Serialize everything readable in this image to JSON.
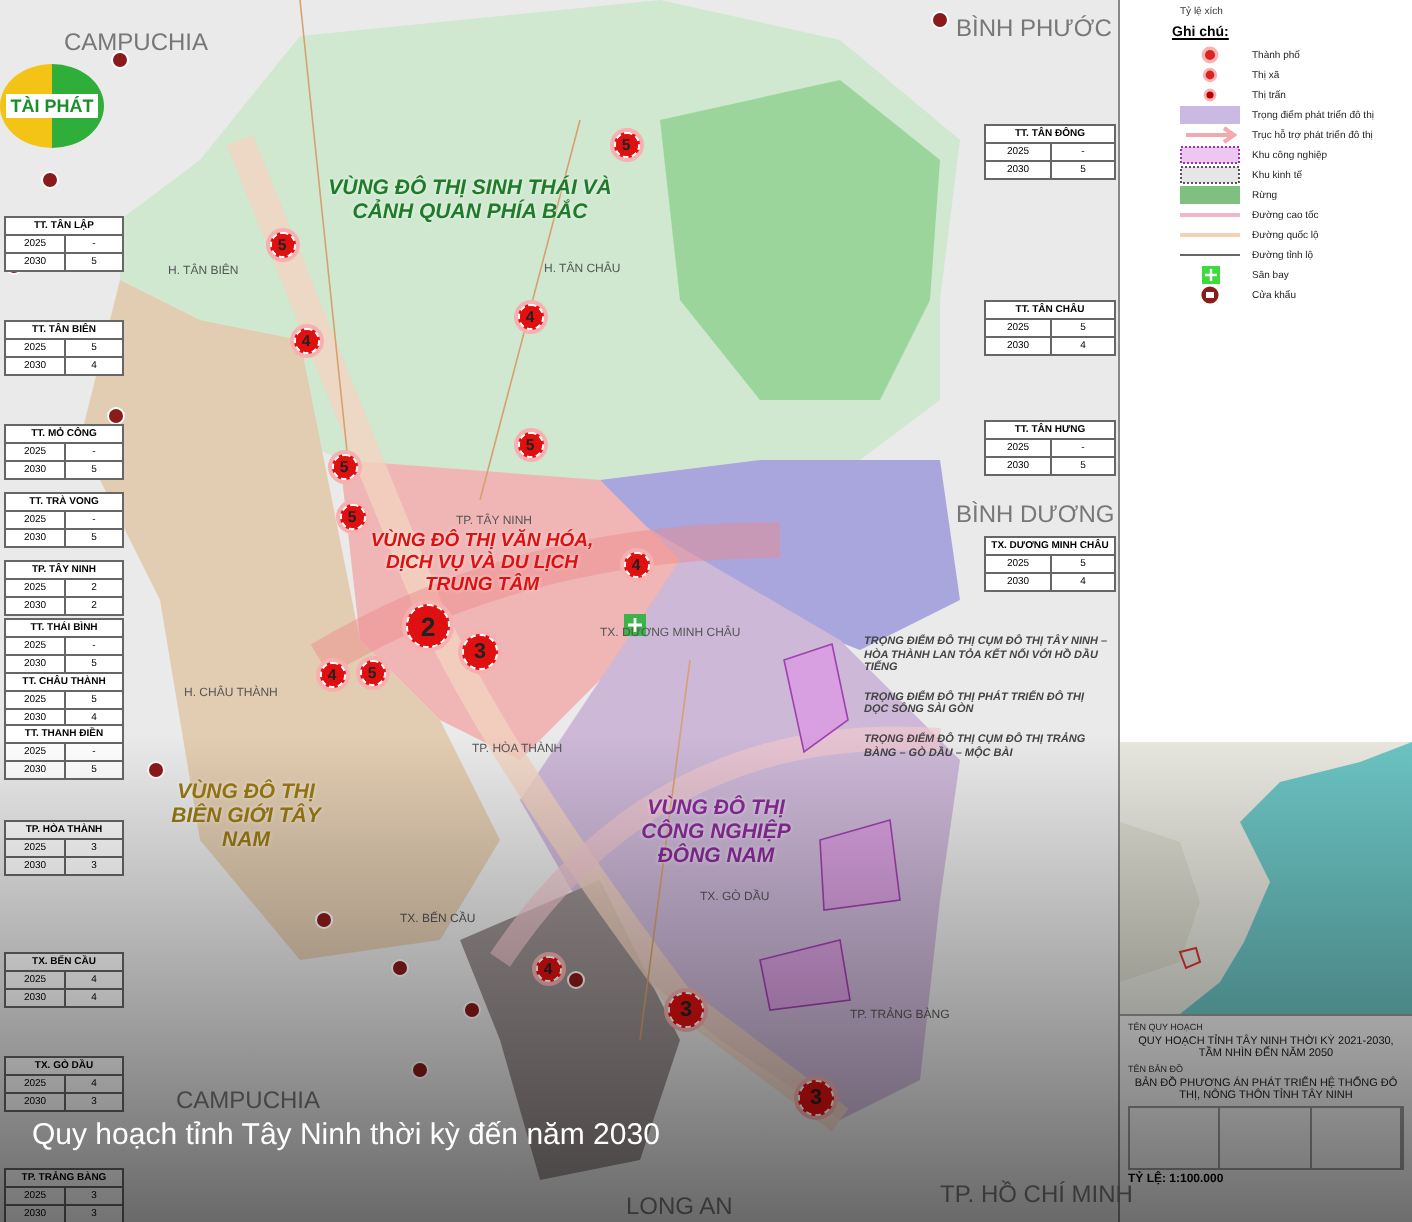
{
  "logo": {
    "text": "TÀI PHÁT"
  },
  "map": {
    "region_labels": [
      {
        "text": "CAMPUCHIA"
      },
      {
        "text": "BÌNH PHƯỚC"
      },
      {
        "text": "BÌNH DƯƠNG"
      },
      {
        "text": "CAMPUCHIA"
      },
      {
        "text": "LONG AN"
      },
      {
        "text": "TP. HỒ CHÍ MINH"
      }
    ],
    "district_labels": [
      {
        "text": "H. TÂN BIÊN"
      },
      {
        "text": "H. TÂN CHÂU"
      },
      {
        "text": "TP. TÂY NINH"
      },
      {
        "text": "TX. DƯƠNG MINH CHÂU"
      },
      {
        "text": "H. CHÂU THÀNH"
      },
      {
        "text": "TP. HÒA THÀNH"
      },
      {
        "text": "TX. GÒ DẦU"
      },
      {
        "text": "TX. BẾN CẦU"
      },
      {
        "text": "TP. TRẢNG BÀNG"
      }
    ],
    "zones": [
      {
        "kind": "eco",
        "text": "VÙNG ĐÔ THỊ SINH THÁI VÀ CẢNH QUAN PHÍA BẮC"
      },
      {
        "kind": "central",
        "text": "VÙNG ĐÔ THỊ VĂN HÓA, DỊCH VỤ VÀ DU LỊCH TRUNG TÂM"
      },
      {
        "kind": "border",
        "text": "VÙNG ĐÔ THỊ BIÊN GIỚI TÂY NAM"
      },
      {
        "kind": "industry",
        "text": "VÙNG ĐÔ THỊ CÔNG NGHIỆP ĐÔNG NAM"
      }
    ],
    "markers": [
      {
        "kind": "town",
        "label": "5"
      },
      {
        "kind": "town",
        "label": "5"
      },
      {
        "kind": "town",
        "label": "4"
      },
      {
        "kind": "town",
        "label": "4"
      },
      {
        "kind": "town",
        "label": "5"
      },
      {
        "kind": "town",
        "label": "5"
      },
      {
        "kind": "town",
        "label": "5"
      },
      {
        "kind": "town",
        "label": "4"
      },
      {
        "kind": "major",
        "label": "2"
      },
      {
        "kind": "town",
        "label": "4"
      },
      {
        "kind": "town",
        "label": "5"
      },
      {
        "kind": "city",
        "label": "3"
      },
      {
        "kind": "town",
        "label": "4"
      },
      {
        "kind": "city",
        "label": "3"
      },
      {
        "kind": "city",
        "label": "3"
      }
    ],
    "notes": [
      "TRỌNG ĐIỂM ĐÔ THỊ CỤM ĐÔ THỊ TÂY NINH – HÒA THÀNH LAN TỎA KẾT NỐI VỚI HỒ DẦU TIẾNG",
      "TRỌNG ĐIỂM ĐÔ THỊ PHÁT TRIỂN ĐÔ THỊ DỌC SÔNG SÀI GÒN",
      "TRỌNG ĐIỂM ĐÔ THỊ CỤM ĐÔ THỊ TRẢNG BÀNG – GÒ DẦU – MỘC BÀI"
    ]
  },
  "left_tables": [
    {
      "title": "TT. TÂN LẬP",
      "rows": [
        [
          "2025",
          "-"
        ],
        [
          "2030",
          "5"
        ]
      ]
    },
    {
      "title": "TT. TÂN BIÊN",
      "rows": [
        [
          "2025",
          "5"
        ],
        [
          "2030",
          "4"
        ]
      ]
    },
    {
      "title": "TT. MỎ CÔNG",
      "rows": [
        [
          "2025",
          "-"
        ],
        [
          "2030",
          "5"
        ]
      ]
    },
    {
      "title": "TT. TRÀ VONG",
      "rows": [
        [
          "2025",
          "-"
        ],
        [
          "2030",
          "5"
        ]
      ]
    },
    {
      "title": "TP. TÂY NINH",
      "rows": [
        [
          "2025",
          "2"
        ],
        [
          "2030",
          "2"
        ]
      ]
    },
    {
      "title": "TT. THÁI BÌNH",
      "rows": [
        [
          "2025",
          "-"
        ],
        [
          "2030",
          "5"
        ]
      ]
    },
    {
      "title": "TT. CHÂU THÀNH",
      "rows": [
        [
          "2025",
          "5"
        ],
        [
          "2030",
          "4"
        ]
      ]
    },
    {
      "title": "TT. THANH ĐIỀN",
      "rows": [
        [
          "2025",
          "-"
        ],
        [
          "2030",
          "5"
        ]
      ]
    },
    {
      "title": "TP. HÒA THÀNH",
      "rows": [
        [
          "2025",
          "3"
        ],
        [
          "2030",
          "3"
        ]
      ]
    },
    {
      "title": "TX. BẾN CẦU",
      "rows": [
        [
          "2025",
          "4"
        ],
        [
          "2030",
          "4"
        ]
      ]
    },
    {
      "title": "TX. GÒ DẦU",
      "rows": [
        [
          "2025",
          "4"
        ],
        [
          "2030",
          "3"
        ]
      ]
    },
    {
      "title": "TP. TRẢNG BÀNG",
      "rows": [
        [
          "2025",
          "3"
        ],
        [
          "2030",
          "3"
        ]
      ]
    }
  ],
  "right_tables": [
    {
      "title": "TT. TÂN ĐÔNG",
      "rows": [
        [
          "2025",
          "-"
        ],
        [
          "2030",
          "5"
        ]
      ]
    },
    {
      "title": "TT. TÂN CHÂU",
      "rows": [
        [
          "2025",
          "5"
        ],
        [
          "2030",
          "4"
        ]
      ]
    },
    {
      "title": "TT. TÂN HƯNG",
      "rows": [
        [
          "2025",
          "-"
        ],
        [
          "2030",
          "5"
        ]
      ]
    },
    {
      "title": "TX. DƯƠNG MINH CHÂU",
      "rows": [
        [
          "2025",
          "5"
        ],
        [
          "2030",
          "4"
        ]
      ]
    }
  ],
  "legend": {
    "scale_label": "Tỷ lệ xích",
    "title": "Ghi chú:",
    "items": [
      {
        "kind": "city",
        "label": "Thành phố"
      },
      {
        "kind": "townlet",
        "label": "Thị xã"
      },
      {
        "kind": "township",
        "label": "Thị trấn"
      },
      {
        "kind": "focus",
        "label": "Trọng điểm phát triển đô thị"
      },
      {
        "kind": "axis",
        "label": "Trục hỗ trợ phát triển đô thị"
      },
      {
        "kind": "industrial",
        "label": "Khu công nghiệp"
      },
      {
        "kind": "economic",
        "label": "Khu kinh tế"
      },
      {
        "kind": "forest",
        "label": "Rừng"
      },
      {
        "kind": "expressway",
        "label": "Đường cao tốc"
      },
      {
        "kind": "highway",
        "label": "Đường quốc lộ"
      },
      {
        "kind": "provincial",
        "label": "Đường tỉnh lộ"
      },
      {
        "kind": "airport",
        "label": "Sân bay"
      },
      {
        "kind": "gate",
        "label": "Cửa khẩu"
      }
    ]
  },
  "title_block": {
    "plan_label": "TÊN QUY HOẠCH",
    "plan_name": "QUY HOẠCH TỈNH TÂY NINH THỜI KỲ 2021-2030, TẦM NHÌN ĐẾN NĂM 2050",
    "map_label": "TÊN BẢN ĐỒ",
    "map_name": "BẢN ĐỒ PHƯƠNG ÁN PHÁT TRIỂN HỆ THỐNG ĐÔ THỊ, NÔNG THÔN TỈNH TÂY NINH",
    "scale": "TỶ LỆ: 1:100.000"
  },
  "caption": "Quy hoạch tỉnh Tây Ninh thời kỳ đến năm 2030"
}
